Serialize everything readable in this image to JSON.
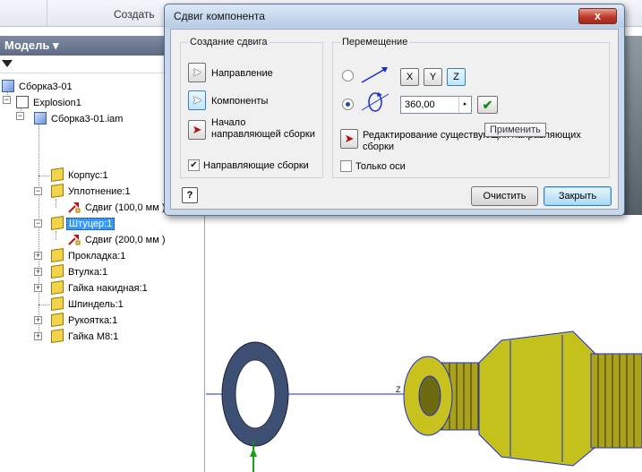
{
  "ribbon": {
    "create_label": "Создать"
  },
  "browser": {
    "title": "Модель",
    "title_arrow": "▾",
    "items": [
      {
        "label": "Сборка3-01",
        "icon": "assembly-icon"
      },
      {
        "label": "Explosion1",
        "icon": "explosion-icon"
      },
      {
        "label": "Сборка3-01.iam",
        "icon": "assembly-icon"
      },
      {
        "label": "Корпус:1",
        "icon": "part-icon"
      },
      {
        "label": "Уплотнение:1",
        "icon": "part-icon"
      },
      {
        "label": "Сдвиг (100,0 мм )",
        "icon": "tweak-icon"
      },
      {
        "label": "Штуцер:1",
        "icon": "part-icon"
      },
      {
        "label": "Сдвиг (200,0 мм )",
        "icon": "tweak-icon"
      },
      {
        "label": "Прокладка:1",
        "icon": "part-icon"
      },
      {
        "label": "Втулка:1",
        "icon": "part-icon"
      },
      {
        "label": "Гайка накидная:1",
        "icon": "part-icon"
      },
      {
        "label": "Шпиндель:1",
        "icon": "part-icon"
      },
      {
        "label": "Рукоятка:1",
        "icon": "part-icon"
      },
      {
        "label": "Гайка М8:1",
        "icon": "part-icon"
      }
    ]
  },
  "dialog": {
    "title": "Сдвиг компонента",
    "close_glyph": "x",
    "create_group": {
      "title": "Создание сдвига",
      "direction_label": "Направление",
      "components_label": "Компоненты",
      "trail_start_label": "Начало направляющей сборки",
      "trails_checkbox_label": "Направляющие сборки",
      "trails_checked": true
    },
    "move_group": {
      "title": "Перемещение",
      "axis_x": "X",
      "axis_y": "Y",
      "axis_z": "Z",
      "active_axis": "Z",
      "rotation_value": "360,00",
      "spin_glyph": "▸",
      "apply_glyph": "✔",
      "edit_label": "Редактирование существующих направляющих сборки",
      "tooltip": "Применить",
      "only_axes_label": "Только оси",
      "only_axes_checked": false
    },
    "help_glyph": "?",
    "clear_button": "Очистить",
    "close_button": "Закрыть"
  },
  "colors": {
    "selection": "#3399ff",
    "part_yellow": "#d8d21a",
    "washer_gray": "#3d4f73",
    "axis_blue": "#1a2bd9",
    "axis_green": "#17a317"
  }
}
